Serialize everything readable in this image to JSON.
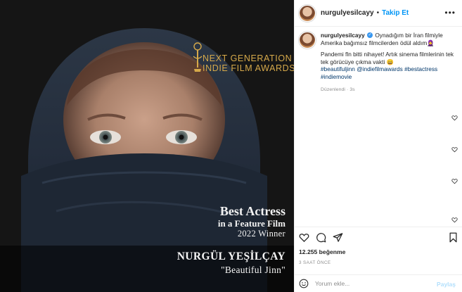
{
  "post": {
    "image": {
      "award": {
        "line1": "NEXT GENERATION",
        "line2": "INDIE FILM AWARDS"
      },
      "caption": {
        "title": "Best Actress",
        "subtitle": "in a Feature Film",
        "year": "2022 Winner",
        "name": "NURGÜL YEŞİLÇAY",
        "film": "\"Beautiful Jinn\""
      }
    },
    "header": {
      "username": "nurgulyesilcayy",
      "separator": "•",
      "follow_label": "Takip Et",
      "more_icon": "more-horizontal-icon"
    },
    "caption": {
      "username": "nurgulyesilcayy",
      "verified_mark": "✓",
      "line1": "Oynadığım bir İran filmiyle Amerika bağımsız filmcilerden ödül aldım🧕",
      "line2": "Pandemi fln bitti nihayet! Artık sinema filmlerinin tek tek görücüye çıkma vakti 😄",
      "hashtags": "#beautifuljinn @indiefilmawards #bestactress #indiemovie",
      "edited": "Düzenlendi · 3s"
    },
    "likes": "12.255 beğenme",
    "time_ago": "3 SAAT ÖNCE",
    "comment": {
      "placeholder": "Yorum ekle...",
      "post_label": "Paylaş"
    }
  },
  "colors": {
    "accent": "#0095f6",
    "award_gold": "#d6a94a",
    "post_disabled": "#b2dffc"
  }
}
